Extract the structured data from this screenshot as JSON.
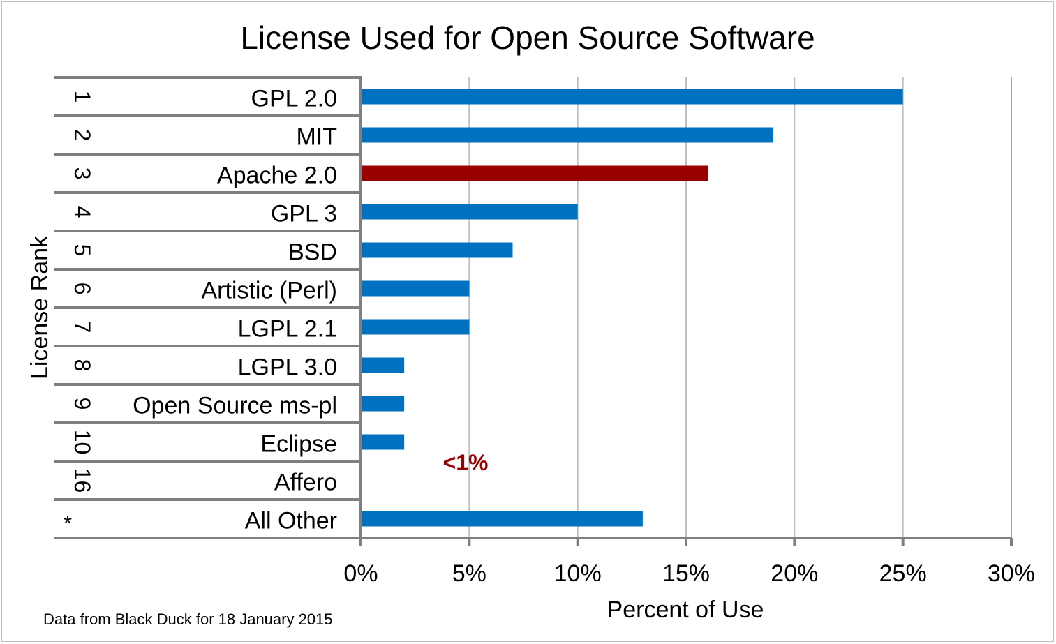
{
  "chart_data": {
    "type": "bar",
    "orientation": "horizontal",
    "title": "License Used for Open Source Software",
    "xlabel": "Percent of Use",
    "ylabel": "License Rank",
    "xlim": [
      0,
      30
    ],
    "xticks": [
      0,
      5,
      10,
      15,
      20,
      25,
      30
    ],
    "xtick_labels": [
      "0%",
      "5%",
      "10%",
      "15%",
      "20%",
      "25%",
      "30%"
    ],
    "grid": "vertical",
    "categories": [
      {
        "rank": "1",
        "label": "GPL 2.0",
        "value": 25,
        "highlight": false
      },
      {
        "rank": "2",
        "label": "MIT",
        "value": 19,
        "highlight": false
      },
      {
        "rank": "3",
        "label": "Apache 2.0",
        "value": 16,
        "highlight": true
      },
      {
        "rank": "4",
        "label": "GPL 3",
        "value": 10,
        "highlight": false
      },
      {
        "rank": "5",
        "label": "BSD",
        "value": 7,
        "highlight": false
      },
      {
        "rank": "6",
        "label": "Artistic (Perl)",
        "value": 5,
        "highlight": false
      },
      {
        "rank": "7",
        "label": "LGPL 2.1",
        "value": 5,
        "highlight": false
      },
      {
        "rank": "8",
        "label": "LGPL 3.0",
        "value": 2,
        "highlight": false
      },
      {
        "rank": "9",
        "label": "Open Source ms-pl",
        "value": 2,
        "highlight": false
      },
      {
        "rank": "10",
        "label": "Eclipse",
        "value": 2,
        "highlight": false
      },
      {
        "rank": "16",
        "label": "Affero",
        "value": 0.5,
        "highlight": true
      },
      {
        "rank": "*",
        "label": "All Other",
        "value": 13,
        "highlight": false
      }
    ],
    "annotations": [
      {
        "text": "<1%",
        "target": "Affero",
        "color": "#990000"
      }
    ],
    "footnote": "Data from Black Duck for 18 January 2015",
    "colors": {
      "bar": "#0070C0",
      "highlight_bar": "#990000",
      "axis": "#808080",
      "grid": "#bfbfbf"
    }
  }
}
